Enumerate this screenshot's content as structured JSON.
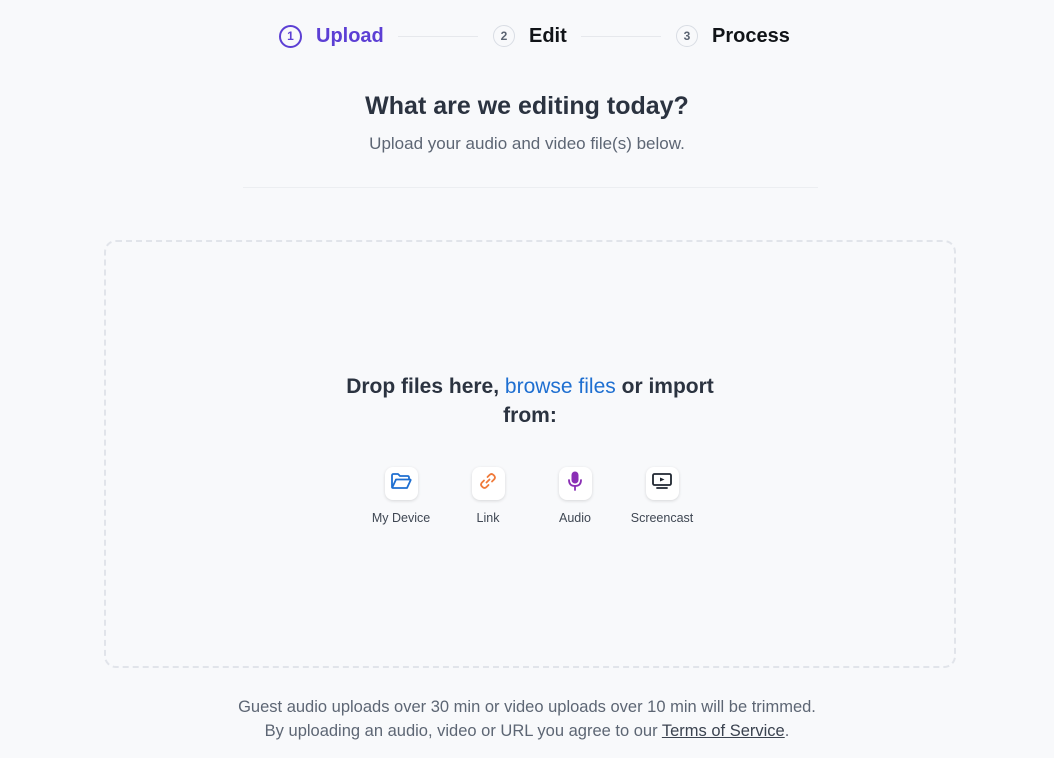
{
  "stepper": {
    "steps": [
      {
        "number": "1",
        "label": "Upload",
        "active": true
      },
      {
        "number": "2",
        "label": "Edit",
        "active": false
      },
      {
        "number": "3",
        "label": "Process",
        "active": false
      }
    ]
  },
  "header": {
    "title": "What are we editing today?",
    "subtitle": "Upload your audio and video file(s) below."
  },
  "dropzone": {
    "text_before": "Drop files here, ",
    "browse_link": "browse files",
    "text_after": " or import from:",
    "sources": [
      {
        "label": "My Device",
        "icon": "folder-icon",
        "color": "#1e6fd1"
      },
      {
        "label": "Link",
        "icon": "link-icon",
        "color": "#f07a3a"
      },
      {
        "label": "Audio",
        "icon": "microphone-icon",
        "color": "#8a2fb5"
      },
      {
        "label": "Screencast",
        "icon": "screencast-icon",
        "color": "#1f2630"
      }
    ]
  },
  "footer": {
    "line1": "Guest audio uploads over 30 min or video uploads over 10 min will be trimmed.",
    "line2_before": "By uploading an audio, video or URL you agree to our ",
    "tos_link": "Terms of Service",
    "line2_after": "."
  },
  "colors": {
    "accent": "#5c3fd4",
    "link": "#1e6fd1",
    "background": "#f8f9fb"
  }
}
